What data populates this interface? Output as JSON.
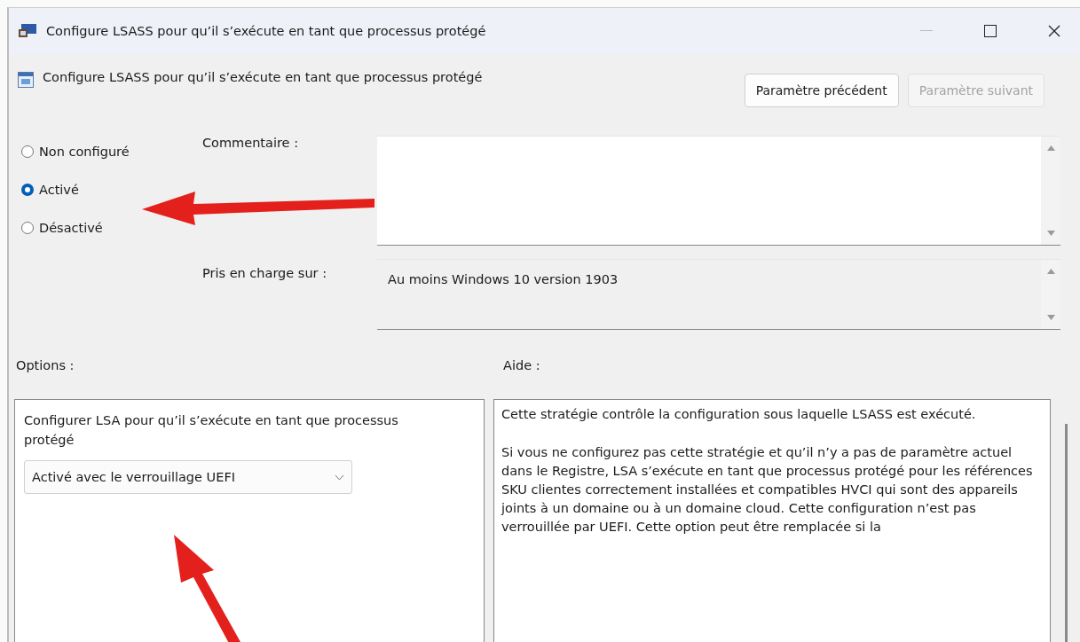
{
  "window": {
    "title": "Configure LSASS pour qu’il s’exécute en tant que processus protégé"
  },
  "header": {
    "setting_name": "Configure LSASS pour qu’il s’exécute en tant que processus protégé",
    "buttons": [
      {
        "label": "Paramètre précédent",
        "disabled": false
      },
      {
        "label": "Paramètre suivant",
        "disabled": true
      }
    ]
  },
  "state_options": [
    {
      "label": "Non configuré",
      "selected": false
    },
    {
      "label": "Activé",
      "selected": true
    },
    {
      "label": "Désactivé",
      "selected": false
    }
  ],
  "comment": {
    "label": "Commentaire :"
  },
  "supported_on": {
    "label": "Pris en charge sur :",
    "value": "Au moins Windows 10 version 1903"
  },
  "options": {
    "label": "Options :",
    "description": "Configurer LSA pour qu’il s’exécute en tant que processus protégé",
    "dropdown_value": "Activé avec le verrouillage UEFI"
  },
  "help": {
    "label": "Aide :",
    "paragraphs": [
      "Cette stratégie contrôle la configuration sous laquelle LSASS est exécuté.",
      "Si vous ne configurez pas cette stratégie et qu’il n’y a pas de paramètre actuel dans le Registre, LSA s’exécute en tant que processus protégé pour les références SKU clientes correctement installées et compatibles HVCI qui sont des appareils joints à un domaine ou à un domaine cloud. Cette configuration n’est pas verrouillée par UEFI. Cette option peut être remplacée si la"
    ]
  }
}
